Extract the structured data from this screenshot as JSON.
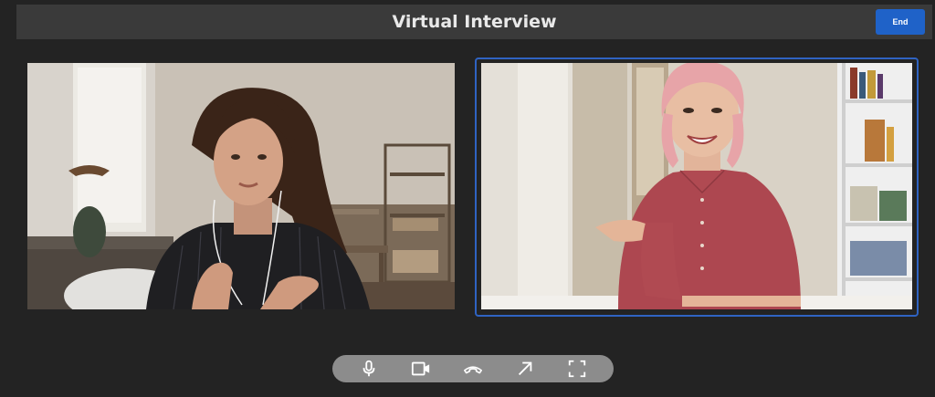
{
  "header": {
    "title": "Virtual Interview",
    "end_label": "End"
  },
  "colors": {
    "background": "#232323",
    "header_bg": "#3a3a3a",
    "accent": "#1f62c8",
    "active_border": "#2f63c2",
    "control_bar": "#8c8c8c"
  },
  "controls": {
    "icons": [
      "microphone-icon",
      "video-camera-icon",
      "hang-up-icon",
      "share-arrow-icon",
      "fullscreen-icon"
    ]
  }
}
